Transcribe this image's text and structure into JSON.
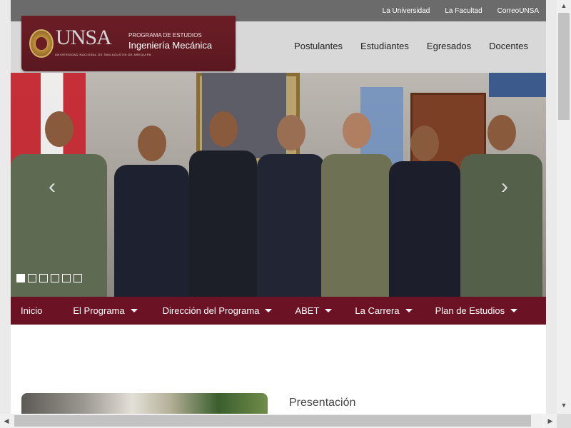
{
  "top_links": [
    "La Universidad",
    "La Facultad",
    "CorreoUNSA"
  ],
  "logo": {
    "text": "UNSA",
    "tagline": "UNIVERSIDAD NACIONAL DE SAN AGUSTIN DE AREQUIPA",
    "program_small": "PROGRAMA DE ESTUDIOS",
    "program_big": "Ingeniería Mecánica"
  },
  "main_nav": [
    "Postulantes",
    "Estudiantes",
    "Egresados",
    "Docentes"
  ],
  "slider": {
    "slide_count": 6,
    "active_index": 0,
    "prev": "‹",
    "next": "›"
  },
  "sub_nav": [
    {
      "label": "Inicio",
      "dropdown": false
    },
    {
      "label": "El Programa",
      "dropdown": true
    },
    {
      "label": "Dirección del Programa",
      "dropdown": true
    },
    {
      "label": "ABET",
      "dropdown": true
    },
    {
      "label": "La Carrera",
      "dropdown": true
    },
    {
      "label": "Plan de Estudios",
      "dropdown": true
    }
  ],
  "section": {
    "title": "Presentación"
  },
  "scrollbars": {
    "up": "▲",
    "down": "▼",
    "left": "◀",
    "right": "▶"
  },
  "colors": {
    "brand": "#6b1224",
    "logo_bg": "#6c1d26",
    "topbar": "#6b6b6b"
  }
}
